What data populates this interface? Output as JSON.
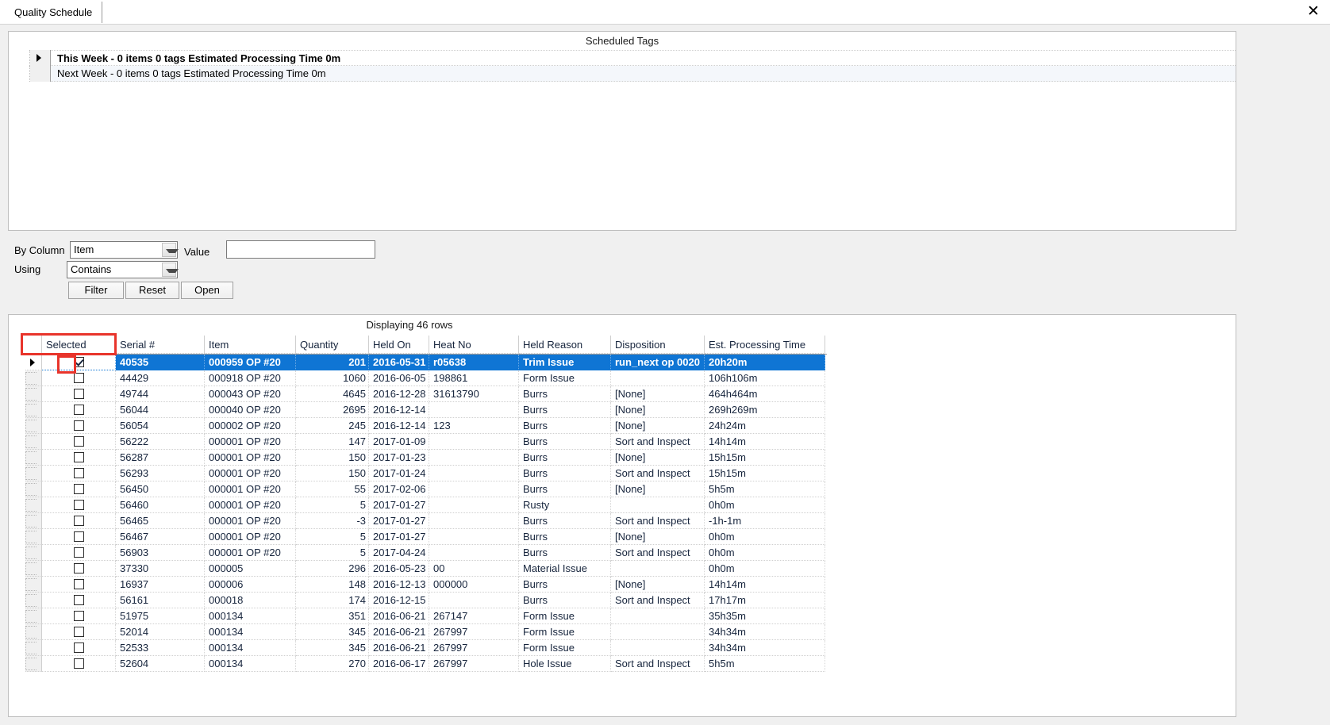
{
  "window": {
    "tab_label": "Quality Schedule",
    "close_icon": "close-icon"
  },
  "scheduled": {
    "title": "Scheduled Tags",
    "rows": [
      {
        "label": "This Week - 0 items 0 tags  Estimated Processing Time 0m"
      },
      {
        "label": "Next Week - 0 items 0 tags  Estimated Processing Time 0m"
      }
    ]
  },
  "filters": {
    "by_column_label": "By Column",
    "by_column_value": "Item",
    "using_label": "Using",
    "using_value": "Contains",
    "value_label": "Value",
    "value_text": "",
    "value_placeholder": "",
    "filter_button": "Filter",
    "reset_button": "Reset",
    "open_button": "Open"
  },
  "grid": {
    "status": "Displaying 46 rows",
    "headers": [
      "Selected",
      "Serial #",
      "Item",
      "Quantity",
      "Held On",
      "Heat No",
      "Held Reason",
      "Disposition",
      "Est. Processing Time"
    ],
    "highlight_color": "#e8342b",
    "selection_color": "#0f75d4",
    "rows": [
      {
        "checked": true,
        "selected": true,
        "serial": "40535",
        "item": "000959 OP #20",
        "quantity": "201",
        "held_on": "2016-05-31",
        "heat_no": "r05638",
        "held_reason": "Trim Issue",
        "disposition": "run_next op 0020",
        "est": "20h20m"
      },
      {
        "checked": false,
        "selected": false,
        "serial": "44429",
        "item": "000918 OP #20",
        "quantity": "1060",
        "held_on": "2016-06-05",
        "heat_no": "198861",
        "held_reason": "Form Issue",
        "disposition": "",
        "est": "106h106m"
      },
      {
        "checked": false,
        "selected": false,
        "serial": "49744",
        "item": "000043 OP #20",
        "quantity": "4645",
        "held_on": "2016-12-28",
        "heat_no": "31613790",
        "held_reason": "Burrs",
        "disposition": "[None]",
        "est": "464h464m"
      },
      {
        "checked": false,
        "selected": false,
        "serial": "56044",
        "item": "000040 OP #20",
        "quantity": "2695",
        "held_on": "2016-12-14",
        "heat_no": "",
        "held_reason": "Burrs",
        "disposition": "[None]",
        "est": "269h269m"
      },
      {
        "checked": false,
        "selected": false,
        "serial": "56054",
        "item": "000002 OP #20",
        "quantity": "245",
        "held_on": "2016-12-14",
        "heat_no": "123",
        "held_reason": "Burrs",
        "disposition": "[None]",
        "est": "24h24m"
      },
      {
        "checked": false,
        "selected": false,
        "serial": "56222",
        "item": "000001 OP #20",
        "quantity": "147",
        "held_on": "2017-01-09",
        "heat_no": "",
        "held_reason": "Burrs",
        "disposition": "Sort and Inspect",
        "est": "14h14m"
      },
      {
        "checked": false,
        "selected": false,
        "serial": "56287",
        "item": "000001 OP #20",
        "quantity": "150",
        "held_on": "2017-01-23",
        "heat_no": "",
        "held_reason": "Burrs",
        "disposition": "[None]",
        "est": "15h15m"
      },
      {
        "checked": false,
        "selected": false,
        "serial": "56293",
        "item": "000001 OP #20",
        "quantity": "150",
        "held_on": "2017-01-24",
        "heat_no": "",
        "held_reason": "Burrs",
        "disposition": "Sort and Inspect",
        "est": "15h15m"
      },
      {
        "checked": false,
        "selected": false,
        "serial": "56450",
        "item": "000001 OP #20",
        "quantity": "55",
        "held_on": "2017-02-06",
        "heat_no": "",
        "held_reason": "Burrs",
        "disposition": "[None]",
        "est": "5h5m"
      },
      {
        "checked": false,
        "selected": false,
        "serial": "56460",
        "item": "000001 OP #20",
        "quantity": "5",
        "held_on": "2017-01-27",
        "heat_no": "",
        "held_reason": "Rusty",
        "disposition": "",
        "est": "0h0m"
      },
      {
        "checked": false,
        "selected": false,
        "serial": "56465",
        "item": "000001 OP #20",
        "quantity": "-3",
        "held_on": "2017-01-27",
        "heat_no": "",
        "held_reason": "Burrs",
        "disposition": "Sort and Inspect",
        "est": "-1h-1m"
      },
      {
        "checked": false,
        "selected": false,
        "serial": "56467",
        "item": "000001 OP #20",
        "quantity": "5",
        "held_on": "2017-01-27",
        "heat_no": "",
        "held_reason": "Burrs",
        "disposition": "[None]",
        "est": "0h0m"
      },
      {
        "checked": false,
        "selected": false,
        "serial": "56903",
        "item": "000001 OP #20",
        "quantity": "5",
        "held_on": "2017-04-24",
        "heat_no": "",
        "held_reason": "Burrs",
        "disposition": "Sort and Inspect",
        "est": "0h0m"
      },
      {
        "checked": false,
        "selected": false,
        "serial": "37330",
        "item": "000005",
        "quantity": "296",
        "held_on": "2016-05-23",
        "heat_no": "00",
        "held_reason": "Material Issue",
        "disposition": "",
        "est": "0h0m"
      },
      {
        "checked": false,
        "selected": false,
        "serial": "16937",
        "item": "000006",
        "quantity": "148",
        "held_on": "2016-12-13",
        "heat_no": "000000",
        "held_reason": "Burrs",
        "disposition": "[None]",
        "est": "14h14m"
      },
      {
        "checked": false,
        "selected": false,
        "serial": "56161",
        "item": "000018",
        "quantity": "174",
        "held_on": "2016-12-15",
        "heat_no": "",
        "held_reason": "Burrs",
        "disposition": "Sort and Inspect",
        "est": "17h17m"
      },
      {
        "checked": false,
        "selected": false,
        "serial": "51975",
        "item": "000134",
        "quantity": "351",
        "held_on": "2016-06-21",
        "heat_no": "267147",
        "held_reason": "Form Issue",
        "disposition": "",
        "est": "35h35m"
      },
      {
        "checked": false,
        "selected": false,
        "serial": "52014",
        "item": "000134",
        "quantity": "345",
        "held_on": "2016-06-21",
        "heat_no": "267997",
        "held_reason": "Form Issue",
        "disposition": "",
        "est": "34h34m"
      },
      {
        "checked": false,
        "selected": false,
        "serial": "52533",
        "item": "000134",
        "quantity": "345",
        "held_on": "2016-06-21",
        "heat_no": "267997",
        "held_reason": "Form Issue",
        "disposition": "",
        "est": "34h34m"
      },
      {
        "checked": false,
        "selected": false,
        "serial": "52604",
        "item": "000134",
        "quantity": "270",
        "held_on": "2016-06-17",
        "heat_no": "267997",
        "held_reason": "Hole Issue",
        "disposition": "Sort and Inspect",
        "est": "5h5m"
      }
    ]
  }
}
